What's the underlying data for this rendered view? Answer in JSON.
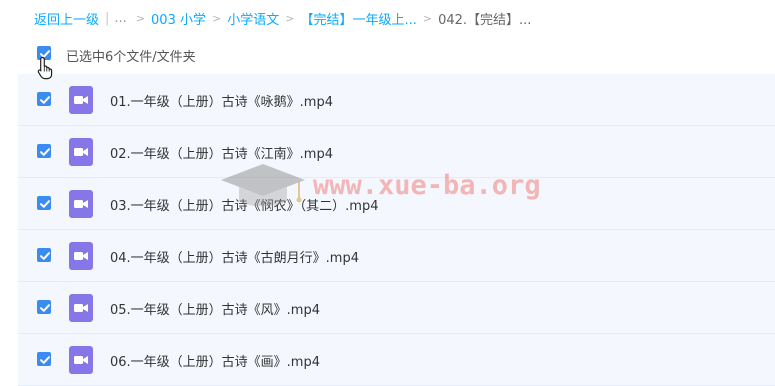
{
  "breadcrumb": {
    "back_label": "返回上一级",
    "ellipsis": "...",
    "items": [
      "003 小学",
      "小学语文",
      "【完结】一年级上..."
    ],
    "current": "042.【完结】...",
    "separator": ">"
  },
  "selection": {
    "status_text": "已选中6个文件/文件夹",
    "all_checked": true
  },
  "files": [
    {
      "name": "01.一年级（上册）古诗《咏鹅》.mp4",
      "checked": true,
      "icon": "video-file-icon"
    },
    {
      "name": "02.一年级（上册）古诗《江南》.mp4",
      "checked": true,
      "icon": "video-file-icon"
    },
    {
      "name": "03.一年级（上册）古诗《悯农》（其二）.mp4",
      "checked": true,
      "icon": "video-file-icon"
    },
    {
      "name": "04.一年级（上册）古诗《古朗月行》.mp4",
      "checked": true,
      "icon": "video-file-icon"
    },
    {
      "name": "05.一年级（上册）古诗《风》.mp4",
      "checked": true,
      "icon": "video-file-icon"
    },
    {
      "name": "06.一年级（上册）古诗《画》.mp4",
      "checked": true,
      "icon": "video-file-icon"
    }
  ],
  "watermark": {
    "text": "www.xue-ba.org",
    "icon": "graduation-cap-icon"
  },
  "colors": {
    "link": "#09aaff",
    "checkbox": "#3a8cf0",
    "row_background": "#f4f8fe",
    "video_icon": "#8676e8",
    "watermark": "#eb5a50"
  }
}
